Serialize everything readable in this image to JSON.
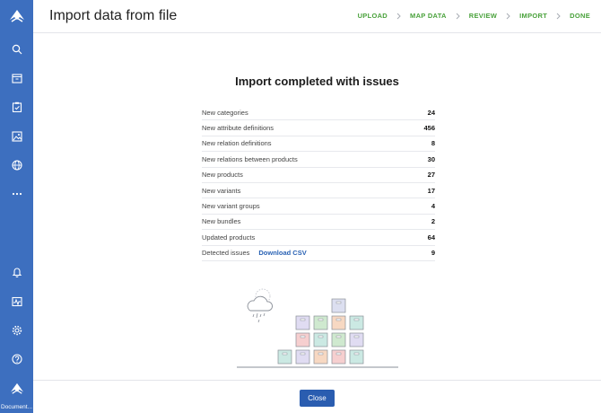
{
  "header": {
    "title": "Import data from file"
  },
  "steps": [
    "UPLOAD",
    "MAP DATA",
    "REVIEW",
    "IMPORT",
    "DONE"
  ],
  "colors": {
    "sidebar": "#3d6fbf",
    "step_active": "#4aa23c",
    "primary_button": "#2a5db0",
    "link": "#2a62b4"
  },
  "sidebar": {
    "icons": [
      "logo-icon",
      "search-icon",
      "catalog-icon",
      "tasks-icon",
      "assets-icon",
      "globe-icon",
      "more-icon",
      "bell-icon",
      "activity-icon",
      "settings-icon",
      "help-icon",
      "logo-icon"
    ],
    "footer_label": "Document..."
  },
  "main": {
    "heading": "Import completed with issues",
    "rows": [
      {
        "label": "New categories",
        "value": "24"
      },
      {
        "label": "New attribute definitions",
        "value": "456"
      },
      {
        "label": "New relation definitions",
        "value": "8"
      },
      {
        "label": "New relations between products",
        "value": "30"
      },
      {
        "label": "New products",
        "value": "27"
      },
      {
        "label": "New variants",
        "value": "17"
      },
      {
        "label": "New variant groups",
        "value": "4"
      },
      {
        "label": "New bundles",
        "value": "2"
      },
      {
        "label": "Updated products",
        "value": "64"
      },
      {
        "label": "Detected issues",
        "value": "9"
      }
    ],
    "download_link": "Download CSV"
  },
  "footer": {
    "close_label": "Close"
  }
}
